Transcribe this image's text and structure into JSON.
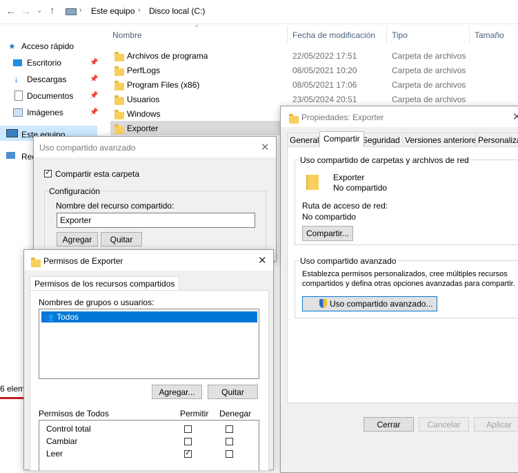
{
  "explorer": {
    "breadcrumb": [
      "Este equipo",
      "Disco local (C:)"
    ],
    "columns": {
      "name": "Nombre",
      "date": "Fecha de modificación",
      "type": "Tipo",
      "size": "Tamaño"
    },
    "nav": [
      {
        "label": "Acceso rápido"
      },
      {
        "label": "Escritorio"
      },
      {
        "label": "Descargas"
      },
      {
        "label": "Documentos"
      },
      {
        "label": "Imágenes"
      },
      {
        "label": "Este equipo"
      },
      {
        "label": "Red"
      }
    ],
    "files": [
      {
        "name": "Archivos de programa",
        "date": "22/05/2022 17:51",
        "type": "Carpeta de archivos"
      },
      {
        "name": "PerfLogs",
        "date": "08/05/2021 10:20",
        "type": "Carpeta de archivos"
      },
      {
        "name": "Program Files (x86)",
        "date": "08/05/2021 17:06",
        "type": "Carpeta de archivos"
      },
      {
        "name": "Usuarios",
        "date": "23/05/2024 20:51",
        "type": "Carpeta de archivos"
      },
      {
        "name": "Windows",
        "date": "",
        "type": ""
      },
      {
        "name": "Exporter",
        "date": "",
        "type": ""
      }
    ],
    "status": "6 elem"
  },
  "properties": {
    "title": "Propiedades: Exporter",
    "tabs": [
      "General",
      "Compartir",
      "Seguridad",
      "Versiones anteriores",
      "Personalizar"
    ],
    "net_group": "Uso compartido de carpetas y archivos de red",
    "folder_name": "Exporter",
    "share_status": "No compartido",
    "path_label": "Ruta de acceso de red:",
    "path_value": "No compartido",
    "share_button": "Compartir...",
    "adv_group": "Uso compartido avanzado",
    "adv_desc": "Establezca permisos personalizados, cree múltiples recursos compartidos y defina otras opciones avanzadas para compartir.",
    "adv_button": "Uso compartido avanzado...",
    "close": "Cerrar",
    "cancel": "Cancelar",
    "apply": "Aplicar"
  },
  "advanced": {
    "title": "Uso compartido avanzado",
    "share_checkbox": "Compartir esta carpeta",
    "config_group": "Configuración",
    "share_name_label": "Nombre del recurso compartido:",
    "share_name_value": "Exporter",
    "add": "Agregar",
    "remove": "Quitar"
  },
  "permissions": {
    "title": "Permisos de Exporter",
    "tab": "Permisos de los recursos compartidos",
    "groups_label": "Nombres de grupos o usuarios:",
    "users": [
      "Todos"
    ],
    "add": "Agregar...",
    "remove": "Quitar",
    "perm_label": "Permisos de Todos",
    "allow": "Permitir",
    "deny": "Denegar",
    "rows": [
      {
        "name": "Control total",
        "allow": false,
        "deny": false
      },
      {
        "name": "Cambiar",
        "allow": false,
        "deny": false
      },
      {
        "name": "Leer",
        "allow": true,
        "deny": false
      }
    ]
  }
}
